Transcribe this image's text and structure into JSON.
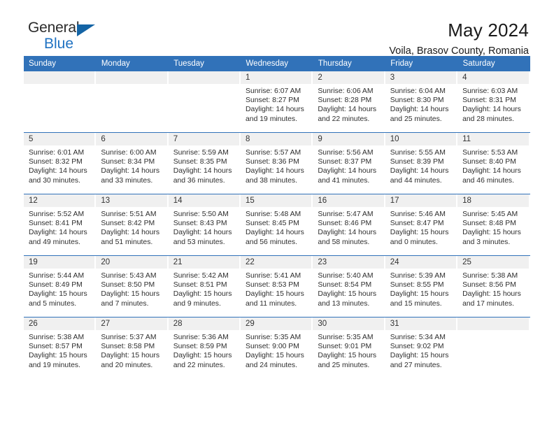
{
  "brand": {
    "name_top": "General",
    "name_bottom": "Blue",
    "triangle_color": "#1464a5",
    "blue_color": "#1f72c2"
  },
  "header": {
    "title": "May 2024",
    "subtitle": "Voila, Brasov County, Romania"
  },
  "theme": {
    "header_bg": "#3172b9",
    "daynum_bg": "#f0f0f0",
    "row_divider": "#3172b9"
  },
  "weekday_headers": [
    "Sunday",
    "Monday",
    "Tuesday",
    "Wednesday",
    "Thursday",
    "Friday",
    "Saturday"
  ],
  "weeks": [
    [
      {
        "day": "",
        "info": ""
      },
      {
        "day": "",
        "info": ""
      },
      {
        "day": "",
        "info": ""
      },
      {
        "day": "1",
        "info": "Sunrise: 6:07 AM\nSunset: 8:27 PM\nDaylight: 14 hours\nand 19 minutes."
      },
      {
        "day": "2",
        "info": "Sunrise: 6:06 AM\nSunset: 8:28 PM\nDaylight: 14 hours\nand 22 minutes."
      },
      {
        "day": "3",
        "info": "Sunrise: 6:04 AM\nSunset: 8:30 PM\nDaylight: 14 hours\nand 25 minutes."
      },
      {
        "day": "4",
        "info": "Sunrise: 6:03 AM\nSunset: 8:31 PM\nDaylight: 14 hours\nand 28 minutes."
      }
    ],
    [
      {
        "day": "5",
        "info": "Sunrise: 6:01 AM\nSunset: 8:32 PM\nDaylight: 14 hours\nand 30 minutes."
      },
      {
        "day": "6",
        "info": "Sunrise: 6:00 AM\nSunset: 8:34 PM\nDaylight: 14 hours\nand 33 minutes."
      },
      {
        "day": "7",
        "info": "Sunrise: 5:59 AM\nSunset: 8:35 PM\nDaylight: 14 hours\nand 36 minutes."
      },
      {
        "day": "8",
        "info": "Sunrise: 5:57 AM\nSunset: 8:36 PM\nDaylight: 14 hours\nand 38 minutes."
      },
      {
        "day": "9",
        "info": "Sunrise: 5:56 AM\nSunset: 8:37 PM\nDaylight: 14 hours\nand 41 minutes."
      },
      {
        "day": "10",
        "info": "Sunrise: 5:55 AM\nSunset: 8:39 PM\nDaylight: 14 hours\nand 44 minutes."
      },
      {
        "day": "11",
        "info": "Sunrise: 5:53 AM\nSunset: 8:40 PM\nDaylight: 14 hours\nand 46 minutes."
      }
    ],
    [
      {
        "day": "12",
        "info": "Sunrise: 5:52 AM\nSunset: 8:41 PM\nDaylight: 14 hours\nand 49 minutes."
      },
      {
        "day": "13",
        "info": "Sunrise: 5:51 AM\nSunset: 8:42 PM\nDaylight: 14 hours\nand 51 minutes."
      },
      {
        "day": "14",
        "info": "Sunrise: 5:50 AM\nSunset: 8:43 PM\nDaylight: 14 hours\nand 53 minutes."
      },
      {
        "day": "15",
        "info": "Sunrise: 5:48 AM\nSunset: 8:45 PM\nDaylight: 14 hours\nand 56 minutes."
      },
      {
        "day": "16",
        "info": "Sunrise: 5:47 AM\nSunset: 8:46 PM\nDaylight: 14 hours\nand 58 minutes."
      },
      {
        "day": "17",
        "info": "Sunrise: 5:46 AM\nSunset: 8:47 PM\nDaylight: 15 hours\nand 0 minutes."
      },
      {
        "day": "18",
        "info": "Sunrise: 5:45 AM\nSunset: 8:48 PM\nDaylight: 15 hours\nand 3 minutes."
      }
    ],
    [
      {
        "day": "19",
        "info": "Sunrise: 5:44 AM\nSunset: 8:49 PM\nDaylight: 15 hours\nand 5 minutes."
      },
      {
        "day": "20",
        "info": "Sunrise: 5:43 AM\nSunset: 8:50 PM\nDaylight: 15 hours\nand 7 minutes."
      },
      {
        "day": "21",
        "info": "Sunrise: 5:42 AM\nSunset: 8:51 PM\nDaylight: 15 hours\nand 9 minutes."
      },
      {
        "day": "22",
        "info": "Sunrise: 5:41 AM\nSunset: 8:53 PM\nDaylight: 15 hours\nand 11 minutes."
      },
      {
        "day": "23",
        "info": "Sunrise: 5:40 AM\nSunset: 8:54 PM\nDaylight: 15 hours\nand 13 minutes."
      },
      {
        "day": "24",
        "info": "Sunrise: 5:39 AM\nSunset: 8:55 PM\nDaylight: 15 hours\nand 15 minutes."
      },
      {
        "day": "25",
        "info": "Sunrise: 5:38 AM\nSunset: 8:56 PM\nDaylight: 15 hours\nand 17 minutes."
      }
    ],
    [
      {
        "day": "26",
        "info": "Sunrise: 5:38 AM\nSunset: 8:57 PM\nDaylight: 15 hours\nand 19 minutes."
      },
      {
        "day": "27",
        "info": "Sunrise: 5:37 AM\nSunset: 8:58 PM\nDaylight: 15 hours\nand 20 minutes."
      },
      {
        "day": "28",
        "info": "Sunrise: 5:36 AM\nSunset: 8:59 PM\nDaylight: 15 hours\nand 22 minutes."
      },
      {
        "day": "29",
        "info": "Sunrise: 5:35 AM\nSunset: 9:00 PM\nDaylight: 15 hours\nand 24 minutes."
      },
      {
        "day": "30",
        "info": "Sunrise: 5:35 AM\nSunset: 9:01 PM\nDaylight: 15 hours\nand 25 minutes."
      },
      {
        "day": "31",
        "info": "Sunrise: 5:34 AM\nSunset: 9:02 PM\nDaylight: 15 hours\nand 27 minutes."
      },
      {
        "day": "",
        "info": ""
      }
    ]
  ]
}
